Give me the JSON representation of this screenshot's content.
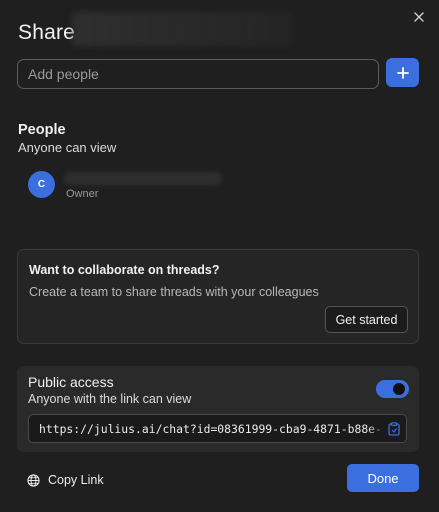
{
  "dialog": {
    "title": "Share",
    "close_icon": "close-icon"
  },
  "add_people": {
    "placeholder": "Add people",
    "value": "",
    "button_icon": "plus-icon"
  },
  "people": {
    "heading": "People",
    "subtitle": "Anyone can view",
    "owner": {
      "avatar_initial": "C",
      "role": "Owner"
    }
  },
  "collaborate": {
    "title": "Want to collaborate on threads?",
    "description": "Create a team to share threads with your colleagues",
    "button_label": "Get started"
  },
  "public_access": {
    "title": "Public access",
    "subtitle": "Anyone with the link can view",
    "enabled": true,
    "link": "https://julius.ai/chat?id=08361999-cba9-4871-b88e-",
    "copy_icon": "clipboard-icon"
  },
  "footer": {
    "copy_link_label": "Copy Link",
    "copy_link_icon": "globe-icon",
    "done_label": "Done"
  },
  "colors": {
    "background": "#1f1f1f",
    "accent": "#3b6fe0",
    "card": "#252525",
    "text": "#ececec"
  }
}
